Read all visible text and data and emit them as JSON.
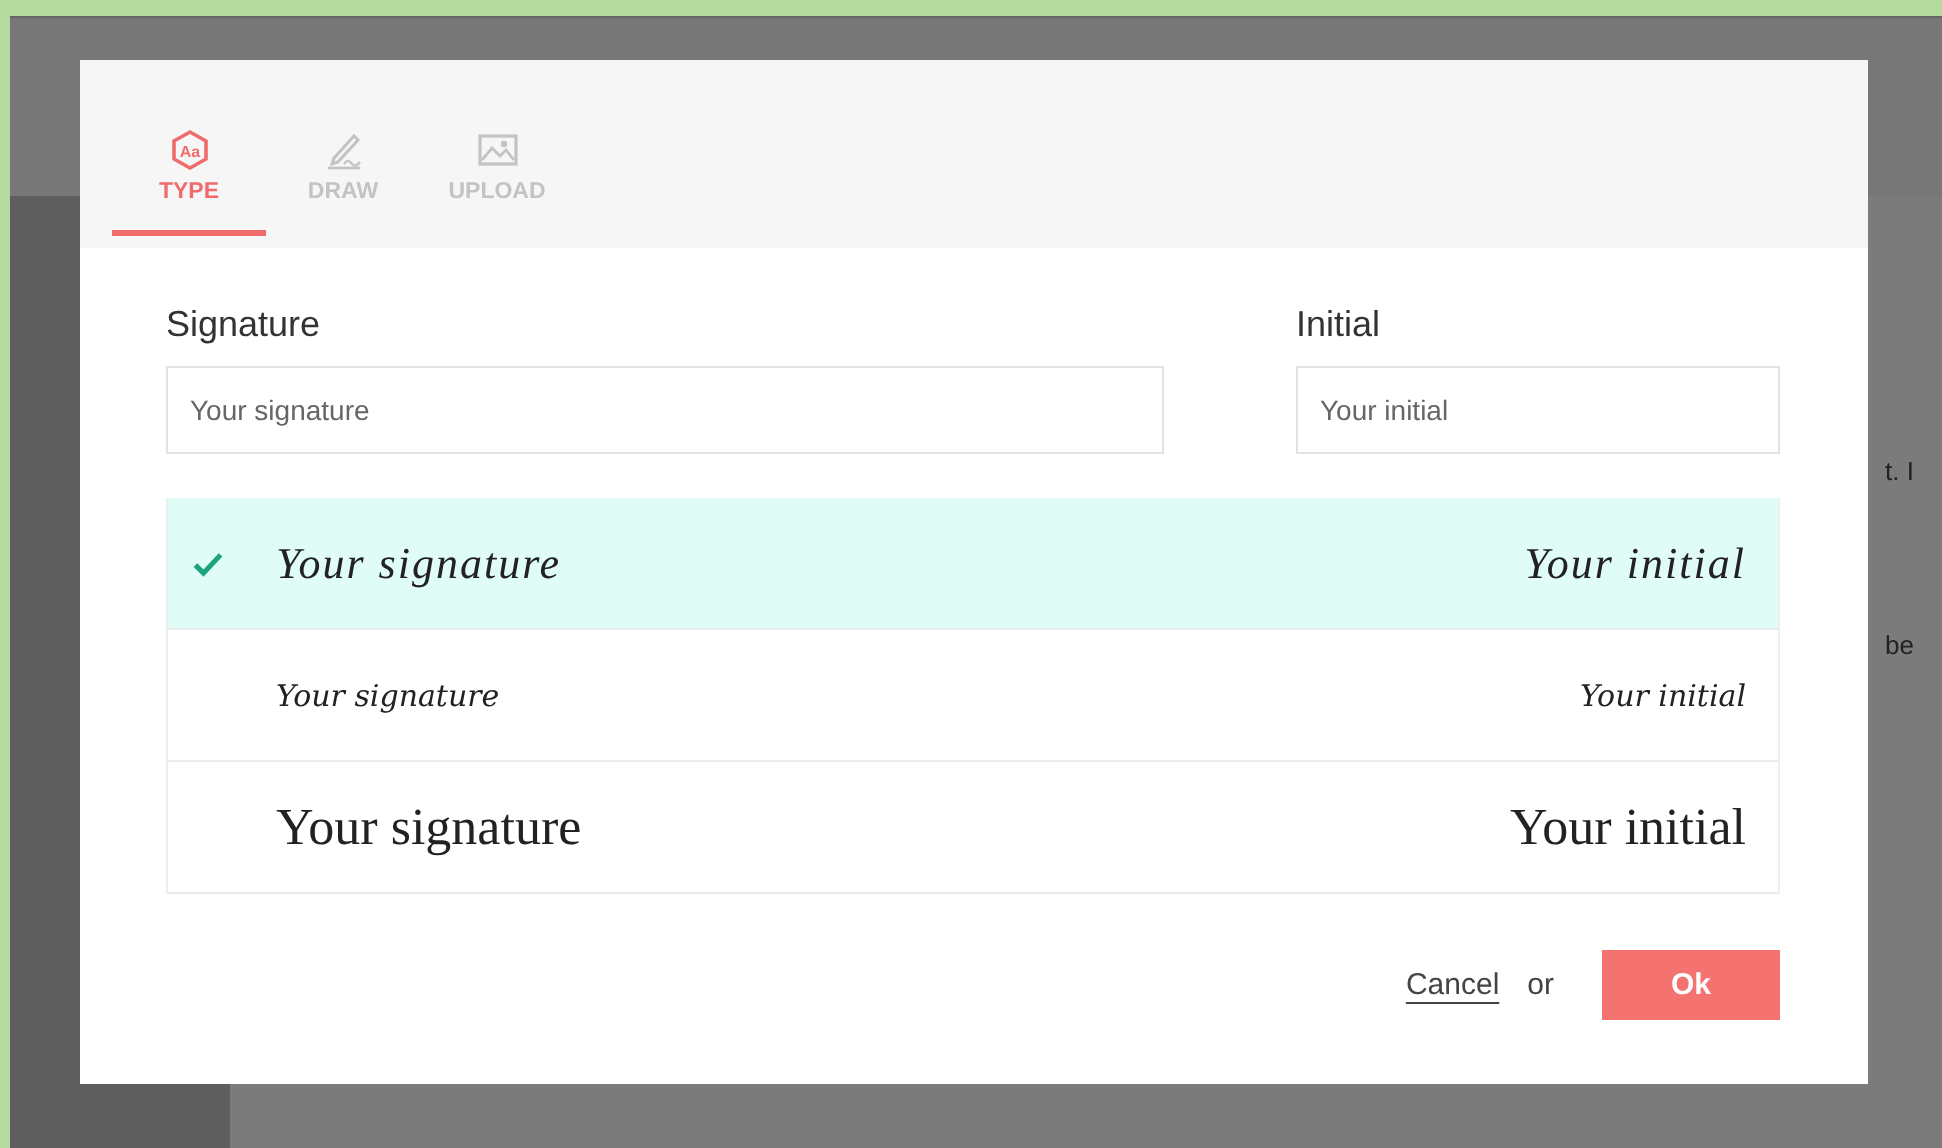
{
  "background": {
    "text_fragments": [
      "t. I",
      "be"
    ]
  },
  "dialog": {
    "tabs": [
      {
        "label": "TYPE",
        "kind": "type",
        "icon_text": "Aa",
        "selected": true
      },
      {
        "label": "DRAW",
        "kind": "draw",
        "selected": false
      },
      {
        "label": "UPLOAD",
        "kind": "upload",
        "selected": false
      }
    ],
    "signature": {
      "label": "Signature",
      "placeholder": "Your signature"
    },
    "initial": {
      "label": "Initial",
      "placeholder": "Your initial"
    },
    "styles": [
      {
        "kind": "slanted",
        "signature": "Your signature",
        "initial": "Your initial",
        "selected": true
      },
      {
        "kind": "small",
        "signature": "Your signature",
        "initial": "Your initial",
        "selected": false
      },
      {
        "kind": "upright",
        "signature": "Your signature",
        "initial": "Your initial",
        "selected": false
      }
    ],
    "cancel": "Cancel",
    "or": "or",
    "ok": "Ok"
  }
}
